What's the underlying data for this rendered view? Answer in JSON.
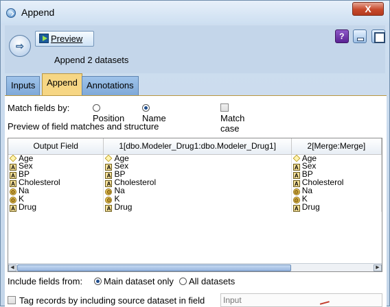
{
  "window": {
    "title": "Append",
    "close_label": "X"
  },
  "header": {
    "preview_label": "Preview",
    "subtitle": "Append 2 datasets",
    "help_label": "?"
  },
  "tabs": [
    {
      "label": "Inputs",
      "active": false
    },
    {
      "label": "Append",
      "active": true
    },
    {
      "label": "Annotations",
      "active": false
    }
  ],
  "match": {
    "label": "Match fields by:",
    "option_position": "Position",
    "option_name": "Name",
    "selected": "Name",
    "match_case_label": "Match case",
    "match_case_checked": false
  },
  "preview_label": "Preview of field matches and structure",
  "table": {
    "columns": [
      "Output Field",
      "1[dbo.Modeler_Drug1:dbo.Modeler_Drug1]",
      "2[Merge:Merge]"
    ],
    "rows": [
      {
        "type": "num",
        "cells": [
          "Age",
          "Age",
          "Age"
        ]
      },
      {
        "type": "str",
        "cells": [
          "Sex",
          "Sex",
          "Sex"
        ]
      },
      {
        "type": "str",
        "cells": [
          "BP",
          "BP",
          "BP"
        ]
      },
      {
        "type": "str",
        "cells": [
          "Cholesterol",
          "Cholesterol",
          "Cholesterol"
        ]
      },
      {
        "type": "flag",
        "cells": [
          "Na",
          "Na",
          "Na"
        ]
      },
      {
        "type": "flag",
        "cells": [
          "K",
          "K",
          "K"
        ]
      },
      {
        "type": "str",
        "cells": [
          "Drug",
          "Drug",
          "Drug"
        ]
      }
    ]
  },
  "include": {
    "label": "Include fields from:",
    "option_main": "Main dataset only",
    "option_all": "All datasets",
    "selected": "Main dataset only"
  },
  "tag": {
    "label": "Tag records by including source dataset in field",
    "checked": false,
    "field_placeholder": "Input"
  },
  "icons": {
    "num": "diamond-icon",
    "str": "letter-a-icon",
    "flag": "flag-field-icon"
  },
  "colors": {
    "active_tab": "#f6d684",
    "tab": "#8fb6e1",
    "close_button": "#c7492b"
  }
}
